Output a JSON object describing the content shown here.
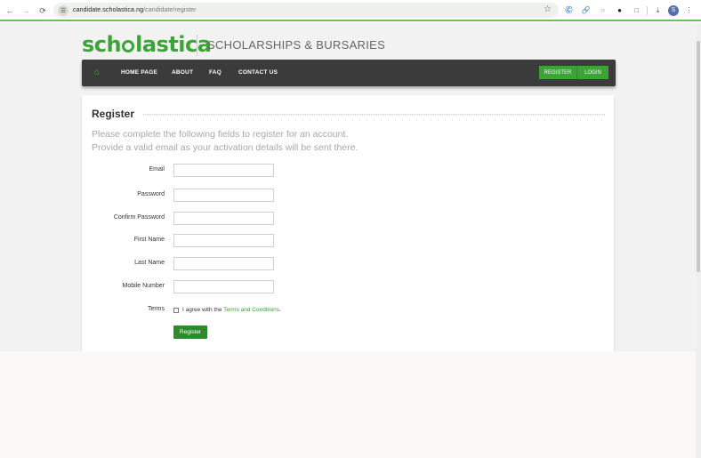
{
  "browser": {
    "url_domain": "candidate.scholastica.ng",
    "url_path": "/candidate/register",
    "profile_initial": "S",
    "icons": [
      "back-icon",
      "forward-icon",
      "reload-icon",
      "site-info-icon",
      "star-icon",
      "extension-icon",
      "link-icon",
      "lock-icon",
      "circle-icon",
      "puzzle-icon",
      "download-icon",
      "menu-icon"
    ]
  },
  "header": {
    "logo_text": "scholastica",
    "logo_pre": "sch",
    "logo_post": "lastica",
    "tagline": "SCHOLARSHIPS & BURSARIES"
  },
  "nav": {
    "items": [
      "HOME PAGE",
      "ABOUT",
      "FAQ",
      "CONTACT US"
    ],
    "register": "REGISTER",
    "login": "LOGIN"
  },
  "form": {
    "title": "Register",
    "intro_line1": "Please complete the following fields to register for an account.",
    "intro_line2": "Provide a valid email as your activation details will be sent there.",
    "fields": [
      {
        "label": "Email",
        "value": "",
        "placeholder": ""
      },
      {
        "label": "Password",
        "value": "",
        "placeholder": ""
      },
      {
        "label": "Confirm Password",
        "value": "",
        "placeholder": ""
      },
      {
        "label": "First Name",
        "value": "",
        "placeholder": ""
      },
      {
        "label": "Last Name",
        "value": "",
        "placeholder": ""
      },
      {
        "label": "Mobile Number",
        "value": "",
        "placeholder": ""
      }
    ],
    "terms_label": "Terms",
    "terms_prefix": "I agree with the ",
    "terms_link": "Terms and Conditions",
    "terms_suffix": ".",
    "submit_label": "Register"
  },
  "colors": {
    "brand": "#3aa535",
    "navbar": "#3b3b3b",
    "button": "#2f8a2b"
  }
}
